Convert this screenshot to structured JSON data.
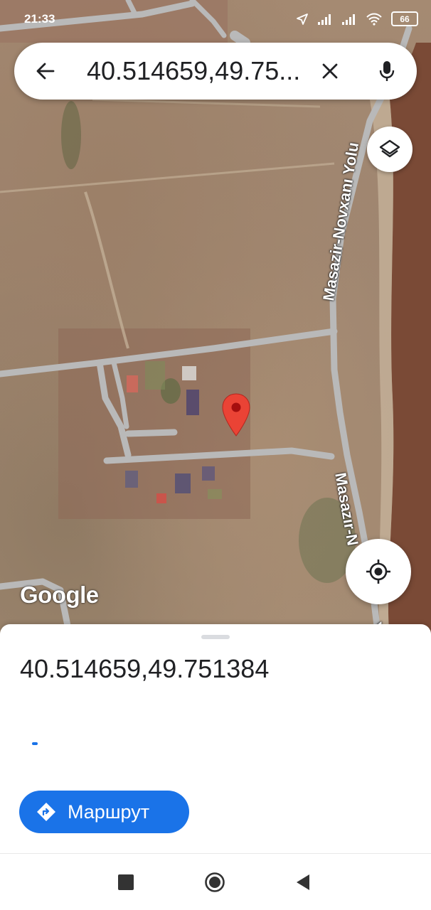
{
  "status_bar": {
    "time": "21:33",
    "battery": "66",
    "icons": [
      "navigation-arrow-icon",
      "signal-icon",
      "signal-icon",
      "wifi-icon",
      "battery-icon"
    ]
  },
  "search": {
    "query": "40.514659,49.75...",
    "back_icon": "arrow-left-icon",
    "clear_icon": "close-icon",
    "mic_icon": "microphone-icon"
  },
  "map": {
    "type": "satellite",
    "road_labels": [
      "Masazir-Novxanı Yolu",
      "Masazır-N"
    ],
    "trailing_road_text": "Y",
    "attribution": "Google",
    "layers_icon": "layers-icon",
    "locate_icon": "my-location-icon",
    "pin_color": "#ea4335"
  },
  "place_sheet": {
    "title": "40.514659,49.751384",
    "route_button_label": "Маршрут",
    "route_icon": "directions-icon",
    "accent_color": "#1a73e8"
  },
  "nav_bar": {
    "icons": [
      "recent-apps-icon",
      "home-icon",
      "back-icon"
    ]
  }
}
